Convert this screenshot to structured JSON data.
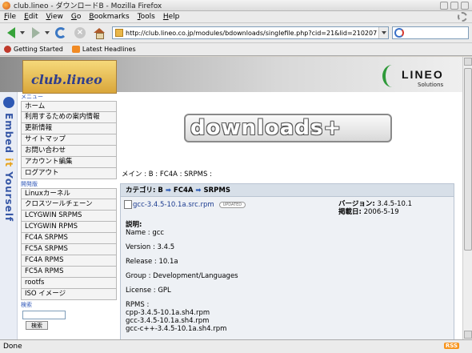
{
  "window": {
    "title": "club.lineo - ダウンロードB - Mozilla Firefox"
  },
  "menu": [
    {
      "pre": "",
      "u": "F",
      "post": "ile"
    },
    {
      "pre": "",
      "u": "E",
      "post": "dit"
    },
    {
      "pre": "",
      "u": "V",
      "post": "iew"
    },
    {
      "pre": "",
      "u": "G",
      "post": "o"
    },
    {
      "pre": "",
      "u": "B",
      "post": "ookmarks"
    },
    {
      "pre": "",
      "u": "T",
      "post": "ools"
    },
    {
      "pre": "",
      "u": "H",
      "post": "elp"
    }
  ],
  "nav": {
    "url": "http://club.lineo.co.jp/modules/bdownloads/singlefile.php?cid=21&lid=210207"
  },
  "bookmarks": [
    "Getting Started",
    "Latest Headlines"
  ],
  "status": {
    "text": "Done",
    "rss": "RSS"
  },
  "site": {
    "club_logo": "club.lineo",
    "lineo_word": "LINEO",
    "lineo_sub": "Solutions",
    "embed_text_1": "Embed ",
    "embed_text_2": "it",
    "embed_text_3": " Yourself"
  },
  "sidebar": {
    "menu_head": "メニュー",
    "menu_items": [
      "ホーム",
      "利用するための案内情報",
      "更新情報",
      "サイトマップ",
      "お問い合わせ",
      "アカウント編集",
      "ログアウト"
    ],
    "dev_head": "開発版",
    "dev_items": [
      "Linuxカーネル",
      "クロスツールチェーン",
      "LCYGWIN SRPMS",
      "LCYGWIN RPMS",
      "FC4A SRPMS",
      "FC5A SRPMS",
      "FC4A RPMS",
      "FC5A RPMS",
      "rootfs",
      "ISO イメージ"
    ],
    "search_head": "検索",
    "search_button": "検索"
  },
  "main": {
    "banner": "downloads+",
    "breadcrumb": "メイン : B : FC4A : SRPMS :",
    "category_label": "カテゴリ: B",
    "category_parts": [
      "FC4A",
      "SRPMS"
    ],
    "file_name": "gcc-3.4.5-10.1a.src.rpm",
    "badge": "UPDATED",
    "version_label": "バージョン:",
    "version_value": "3.4.5-10.1",
    "date_label": "掲載日:",
    "date_value": "2006-5-19",
    "desc_lines": [
      "説明:",
      "Name : gcc",
      "",
      "Version : 3.4.5",
      "",
      "Release : 10.1a",
      "",
      "Group : Development/Languages",
      "",
      "License : GPL",
      "",
      "RPMS :",
      "cpp-3.4.5-10.1a.sh4.rpm",
      "gcc-3.4.5-10.1a.sh4.rpm",
      "gcc-c++-3.4.5-10.1a.sh4.rpm"
    ]
  }
}
